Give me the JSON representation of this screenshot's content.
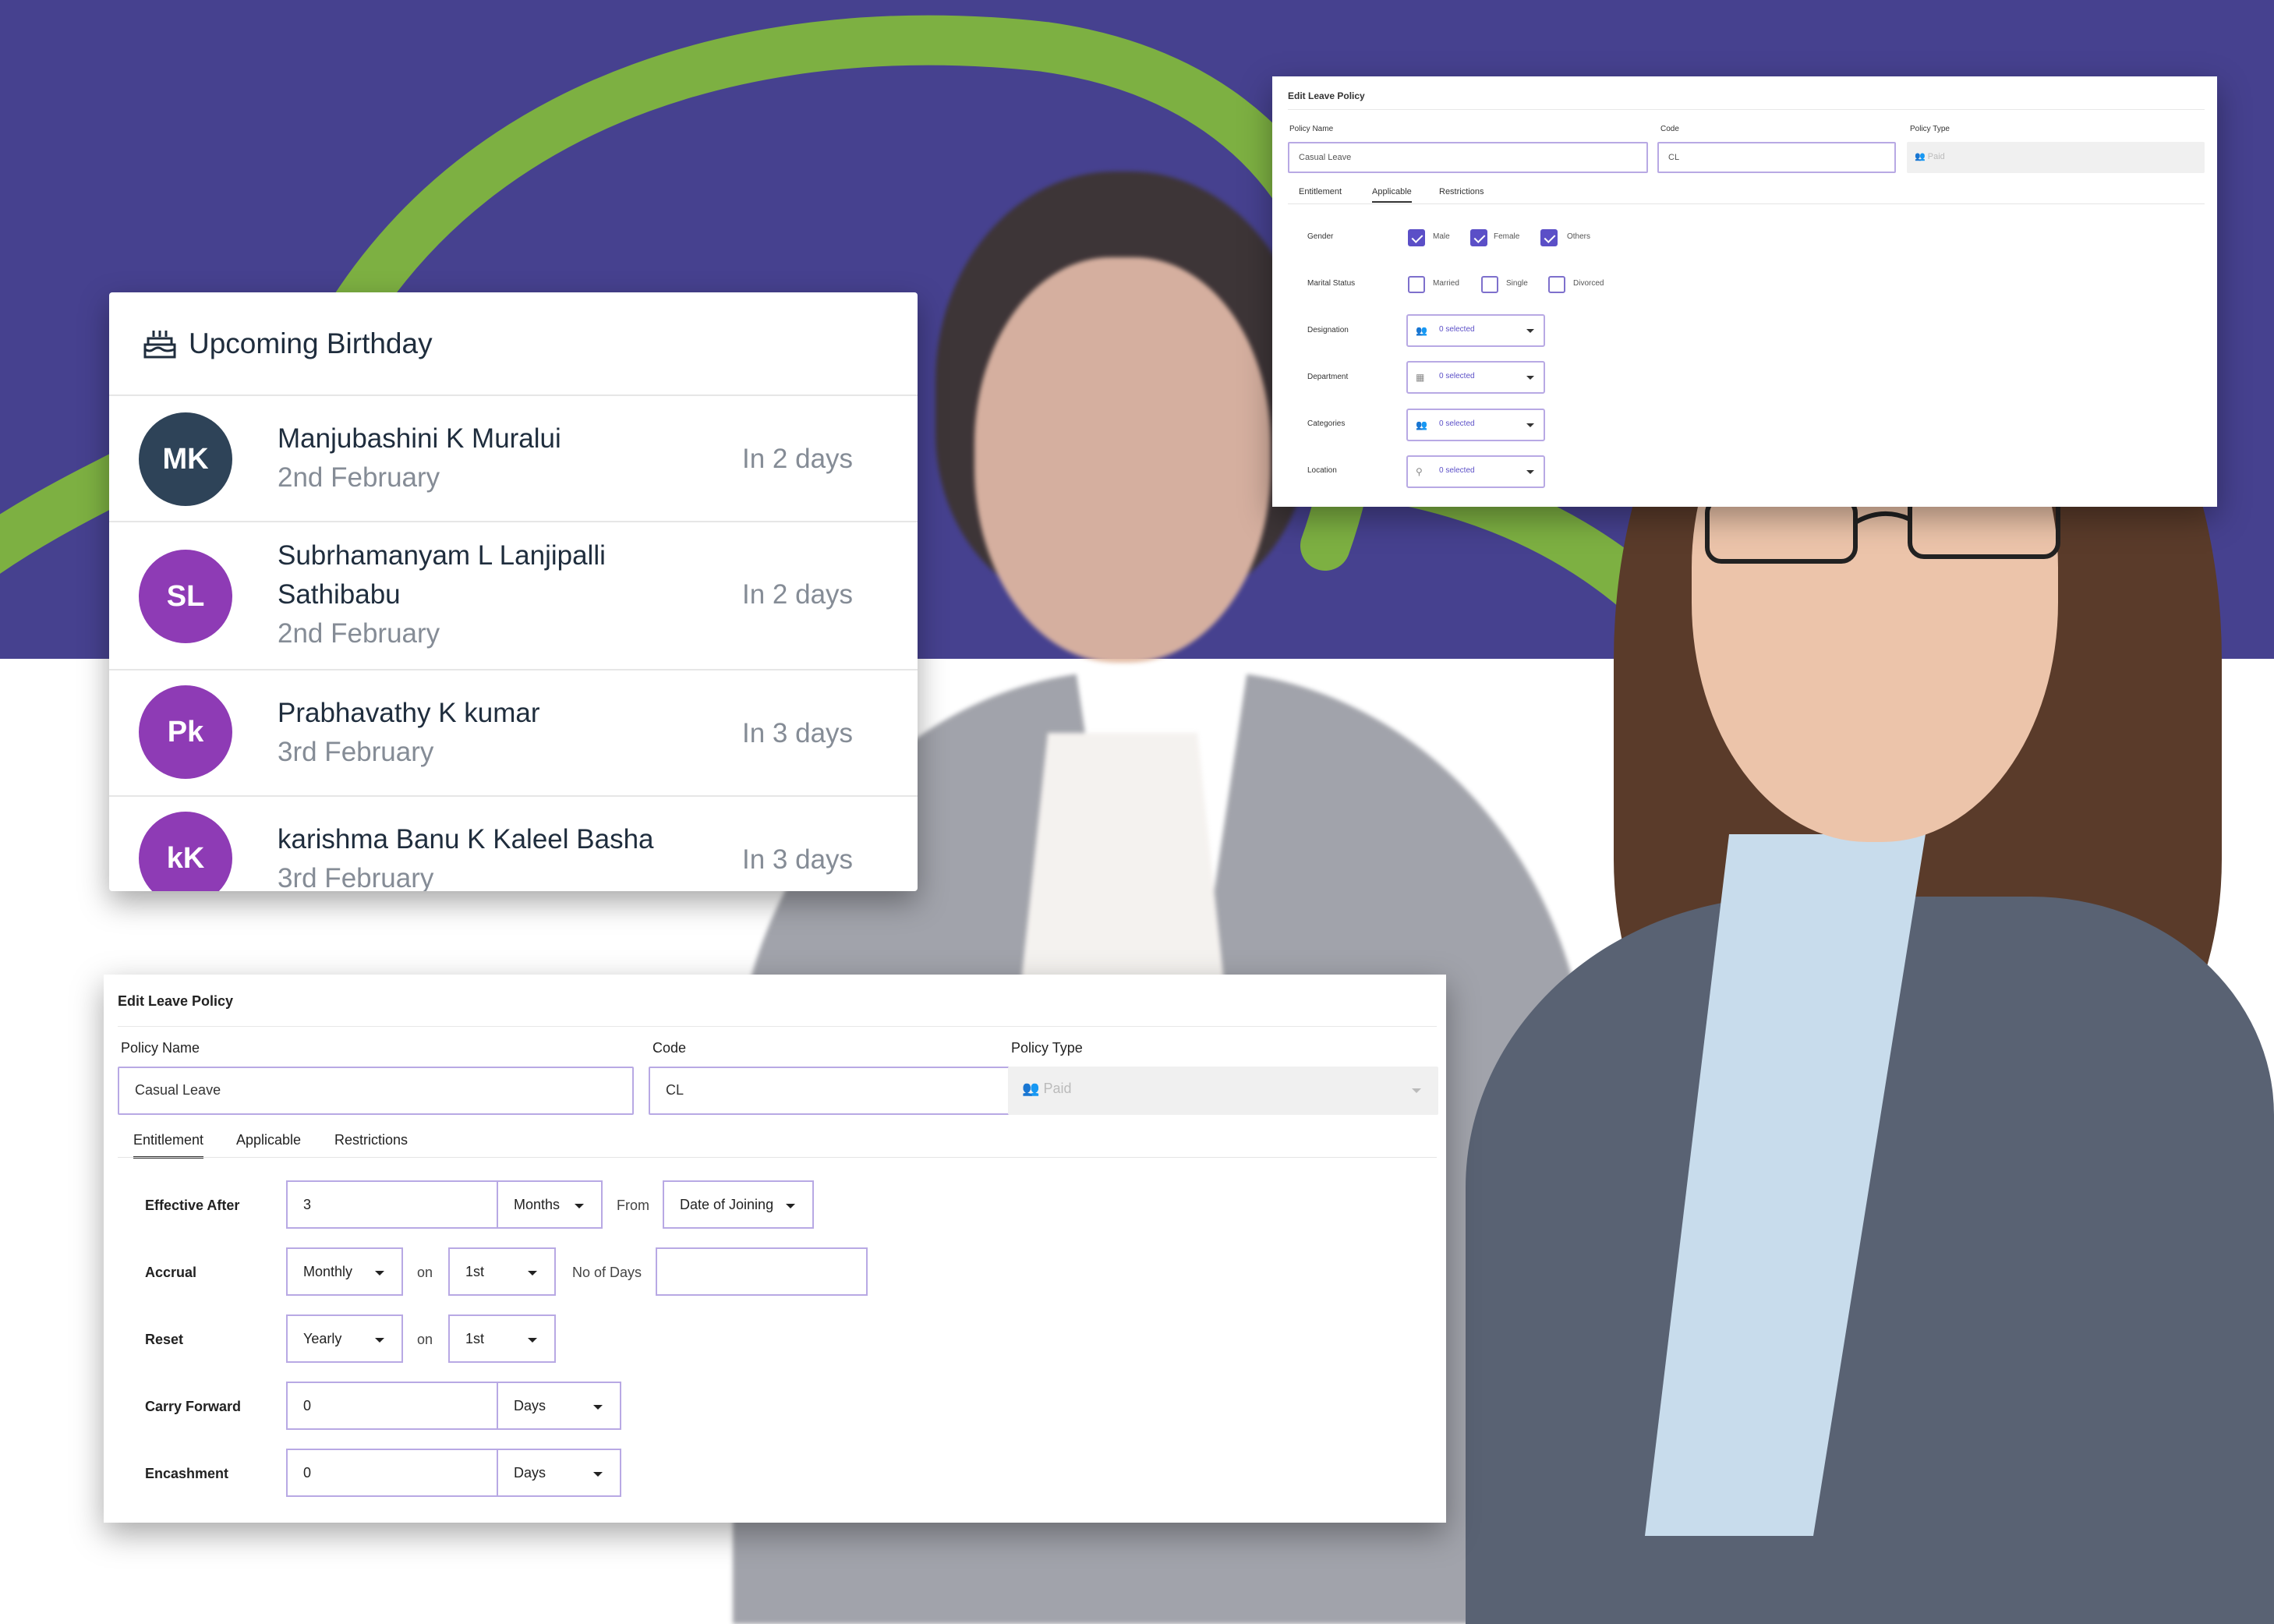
{
  "birthday": {
    "title": "Upcoming Birthday",
    "icon": "cake-icon",
    "people": [
      {
        "initials": "MK",
        "name": "Manjubashini K Muralui",
        "date": "2nd February",
        "when": "In 2 days",
        "color": "#2e4358"
      },
      {
        "initials": "SL",
        "name": "Subrhamanyam L Lanjipalli Sathibabu",
        "date": "2nd February",
        "when": "In 2 days",
        "color": "#8e3bb5"
      },
      {
        "initials": "Pk",
        "name": "Prabhavathy K kumar",
        "date": "3rd February",
        "when": "In 3 days",
        "color": "#8e3bb5"
      },
      {
        "initials": "kK",
        "name": "karishma Banu K Kaleel Basha",
        "date": "3rd February",
        "when": "In 3 days",
        "color": "#8e3bb5"
      }
    ]
  },
  "policy_small": {
    "title": "Edit Leave Policy",
    "policy_name_label": "Policy Name",
    "policy_name": "Casual Leave",
    "code_label": "Code",
    "code": "CL",
    "policy_type_label": "Policy Type",
    "policy_type": "Paid",
    "tabs": [
      "Entitlement",
      "Applicable",
      "Restrictions"
    ],
    "active_tab": "Applicable",
    "gender_label": "Gender",
    "gender_options": [
      {
        "label": "Male",
        "checked": true
      },
      {
        "label": "Female",
        "checked": true
      },
      {
        "label": "Others",
        "checked": true
      }
    ],
    "marital_label": "Marital Status",
    "marital_options": [
      {
        "label": "Married",
        "checked": false
      },
      {
        "label": "Single",
        "checked": false
      },
      {
        "label": "Divorced",
        "checked": false
      }
    ],
    "multiselects": [
      {
        "label": "Designation",
        "value": "0 selected",
        "icon": "users-icon"
      },
      {
        "label": "Department",
        "value": "0 selected",
        "icon": "building-icon"
      },
      {
        "label": "Categories",
        "value": "0 selected",
        "icon": "users-icon"
      },
      {
        "label": "Location",
        "value": "0 selected",
        "icon": "location-icon"
      }
    ]
  },
  "policy_big": {
    "title": "Edit Leave Policy",
    "policy_name_label": "Policy Name",
    "policy_name": "Casual Leave",
    "code_label": "Code",
    "code": "CL",
    "policy_type_label": "Policy Type",
    "policy_type": "Paid",
    "tabs": [
      "Entitlement",
      "Applicable",
      "Restrictions"
    ],
    "active_tab": "Entitlement",
    "effective_after": {
      "label": "Effective After",
      "value": "3",
      "unit": "Months",
      "from_label": "From",
      "from": "Date of Joining"
    },
    "accrual": {
      "label": "Accrual",
      "frequency": "Monthly",
      "on_label": "on",
      "on": "1st",
      "days_label": "No of Days",
      "days": ""
    },
    "reset": {
      "label": "Reset",
      "frequency": "Yearly",
      "on_label": "on",
      "on": "1st"
    },
    "carry_forward": {
      "label": "Carry Forward",
      "value": "0",
      "unit": "Days"
    },
    "encashment": {
      "label": "Encashment",
      "value": "0",
      "unit": "Days"
    }
  },
  "colors": {
    "band": "#46418f",
    "accent": "#7db042",
    "check": "#5b4fc7",
    "input_border": "#b8a9e4"
  }
}
